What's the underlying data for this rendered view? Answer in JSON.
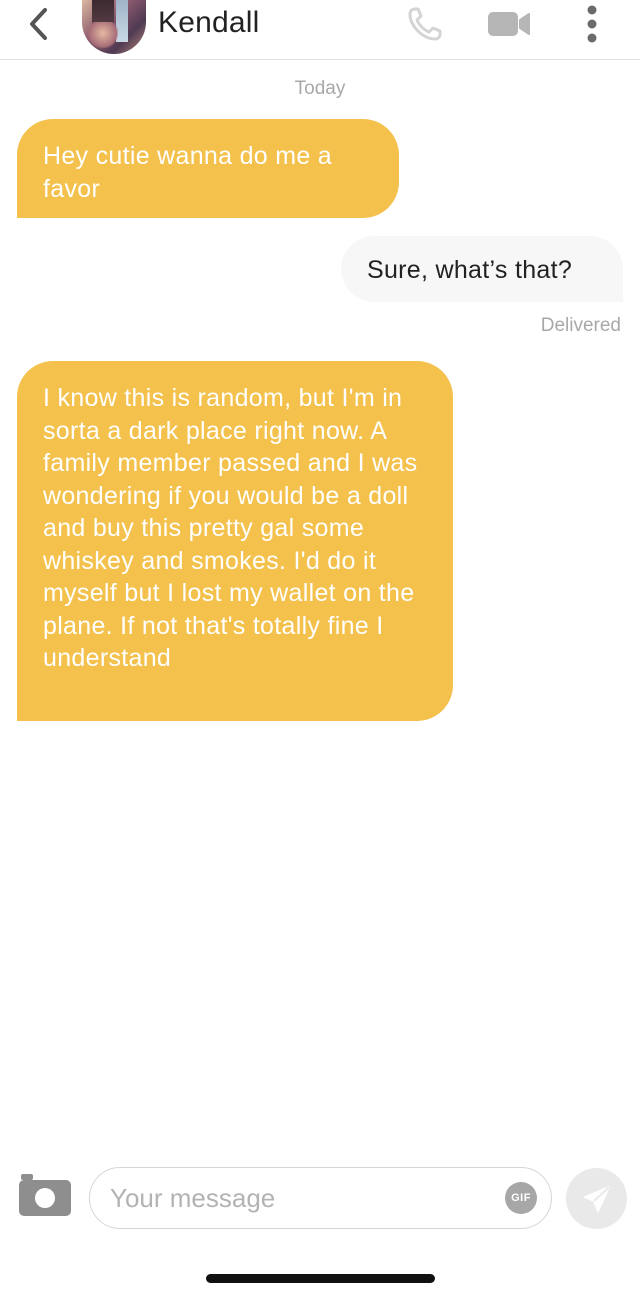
{
  "header": {
    "contact_name": "Kendall",
    "icons": [
      "back-chevron-icon",
      "phone-icon",
      "video-camera-icon",
      "more-vertical-icon"
    ]
  },
  "conversation": {
    "date_label": "Today",
    "messages": [
      {
        "direction": "incoming",
        "text": "Hey cutie wanna do me a favor"
      },
      {
        "direction": "outgoing",
        "text": "Sure, what’s that?"
      },
      {
        "direction": "incoming",
        "text": "I know this is random, but I'm in sorta a dark place right now. A family member passed and I was wondering if you would be a doll and buy this pretty gal some whiskey and smokes. I'd do it myself but I lost my wallet on the plane. If not that's totally fine I understand"
      }
    ],
    "delivery_status": "Delivered"
  },
  "composer": {
    "placeholder": "Your message",
    "value": "",
    "gif_label": "GIF",
    "icons": [
      "camera-icon",
      "send-icon"
    ]
  },
  "colors": {
    "incoming_bubble": "#f3c14c",
    "outgoing_bubble": "#f7f7f7",
    "muted_text": "#a8a8a8"
  }
}
